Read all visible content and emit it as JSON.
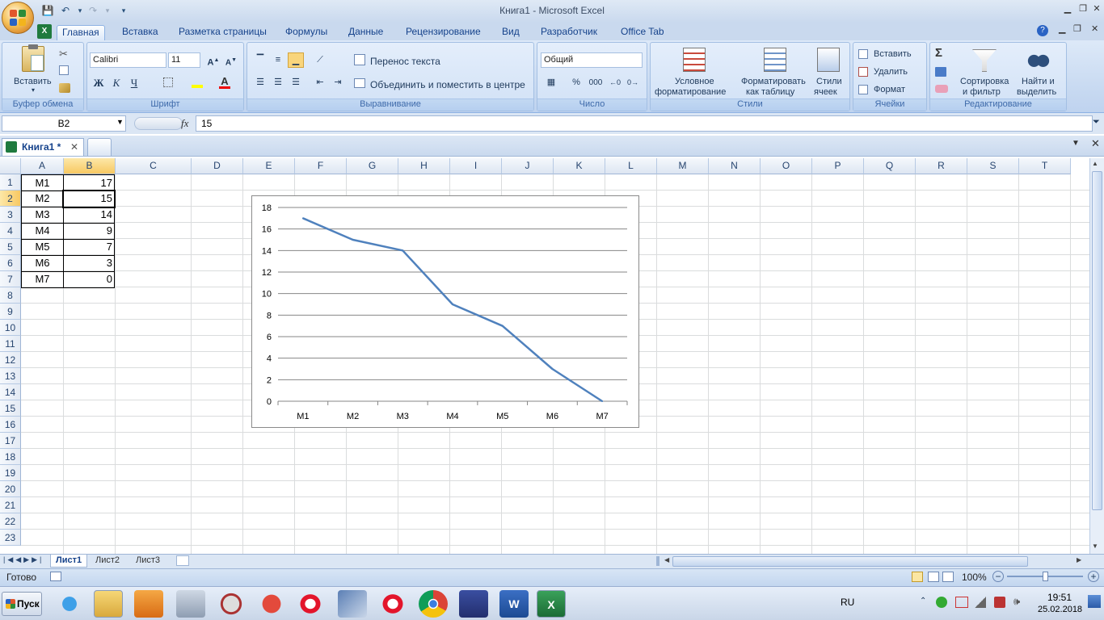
{
  "window": {
    "title": "Книга1 - Microsoft Excel"
  },
  "tabs": [
    "Главная",
    "Вставка",
    "Разметка страницы",
    "Формулы",
    "Данные",
    "Рецензирование",
    "Вид",
    "Разработчик",
    "Office Tab"
  ],
  "ribbon": {
    "clipboard": {
      "paste": "Вставить",
      "label": "Буфер обмена"
    },
    "font": {
      "name": "Calibri",
      "size": "11",
      "bold": "Ж",
      "italic": "К",
      "underline": "Ч",
      "label": "Шрифт"
    },
    "alignment": {
      "wrap": "Перенос текста",
      "merge": "Объединить и поместить в центре",
      "label": "Выравнивание"
    },
    "number": {
      "format": "Общий",
      "percent": "%",
      "thousands": "000",
      "label": "Число"
    },
    "styles": {
      "conditional": "Условное",
      "conditional2": "форматирование",
      "astable": "Форматировать",
      "astable2": "как таблицу",
      "cellstyles": "Стили",
      "cellstyles2": "ячеек",
      "label": "Стили"
    },
    "cells": {
      "insert": "Вставить",
      "delete": "Удалить",
      "format": "Формат",
      "label": "Ячейки"
    },
    "editing": {
      "sort": "Сортировка",
      "sort2": "и фильтр",
      "find": "Найти и",
      "find2": "выделить",
      "label": "Редактирование",
      "sigma": "Σ"
    }
  },
  "formula_bar": {
    "namebox": "B2",
    "fx": "fx",
    "value": "15"
  },
  "doc_tab": {
    "name": "Книга1 *"
  },
  "columns": [
    "A",
    "B",
    "C",
    "D",
    "E",
    "F",
    "G",
    "H",
    "I",
    "J",
    "K",
    "L",
    "M",
    "N",
    "O",
    "P",
    "Q",
    "R",
    "S",
    "T"
  ],
  "rows": [
    "1",
    "2",
    "3",
    "4",
    "5",
    "6",
    "7",
    "8",
    "9",
    "10",
    "11",
    "12",
    "13",
    "14",
    "15",
    "16",
    "17",
    "18",
    "19",
    "20",
    "21",
    "22",
    "23"
  ],
  "cells": [
    {
      "a": "M1",
      "b": "17"
    },
    {
      "a": "M2",
      "b": "15"
    },
    {
      "a": "M3",
      "b": "14"
    },
    {
      "a": "M4",
      "b": "9"
    },
    {
      "a": "M5",
      "b": "7"
    },
    {
      "a": "M6",
      "b": "3"
    },
    {
      "a": "M7",
      "b": "0"
    }
  ],
  "chart_data": {
    "type": "line",
    "categories": [
      "M1",
      "M2",
      "M3",
      "M4",
      "M5",
      "M6",
      "M7"
    ],
    "series": [
      {
        "values": [
          17,
          15,
          14,
          9,
          7,
          3,
          0
        ],
        "color": "#4f81bd"
      }
    ],
    "ylim": [
      0,
      18
    ],
    "yticks": [
      0,
      2,
      4,
      6,
      8,
      10,
      12,
      14,
      16,
      18
    ],
    "grid": true,
    "legend": "none"
  },
  "sheets": [
    "Лист1",
    "Лист2",
    "Лист3"
  ],
  "status": {
    "ready": "Готово",
    "zoom": "100%"
  },
  "taskbar": {
    "start": "Пуск",
    "lang": "RU",
    "time": "19:51",
    "date": "25.02.2018"
  }
}
